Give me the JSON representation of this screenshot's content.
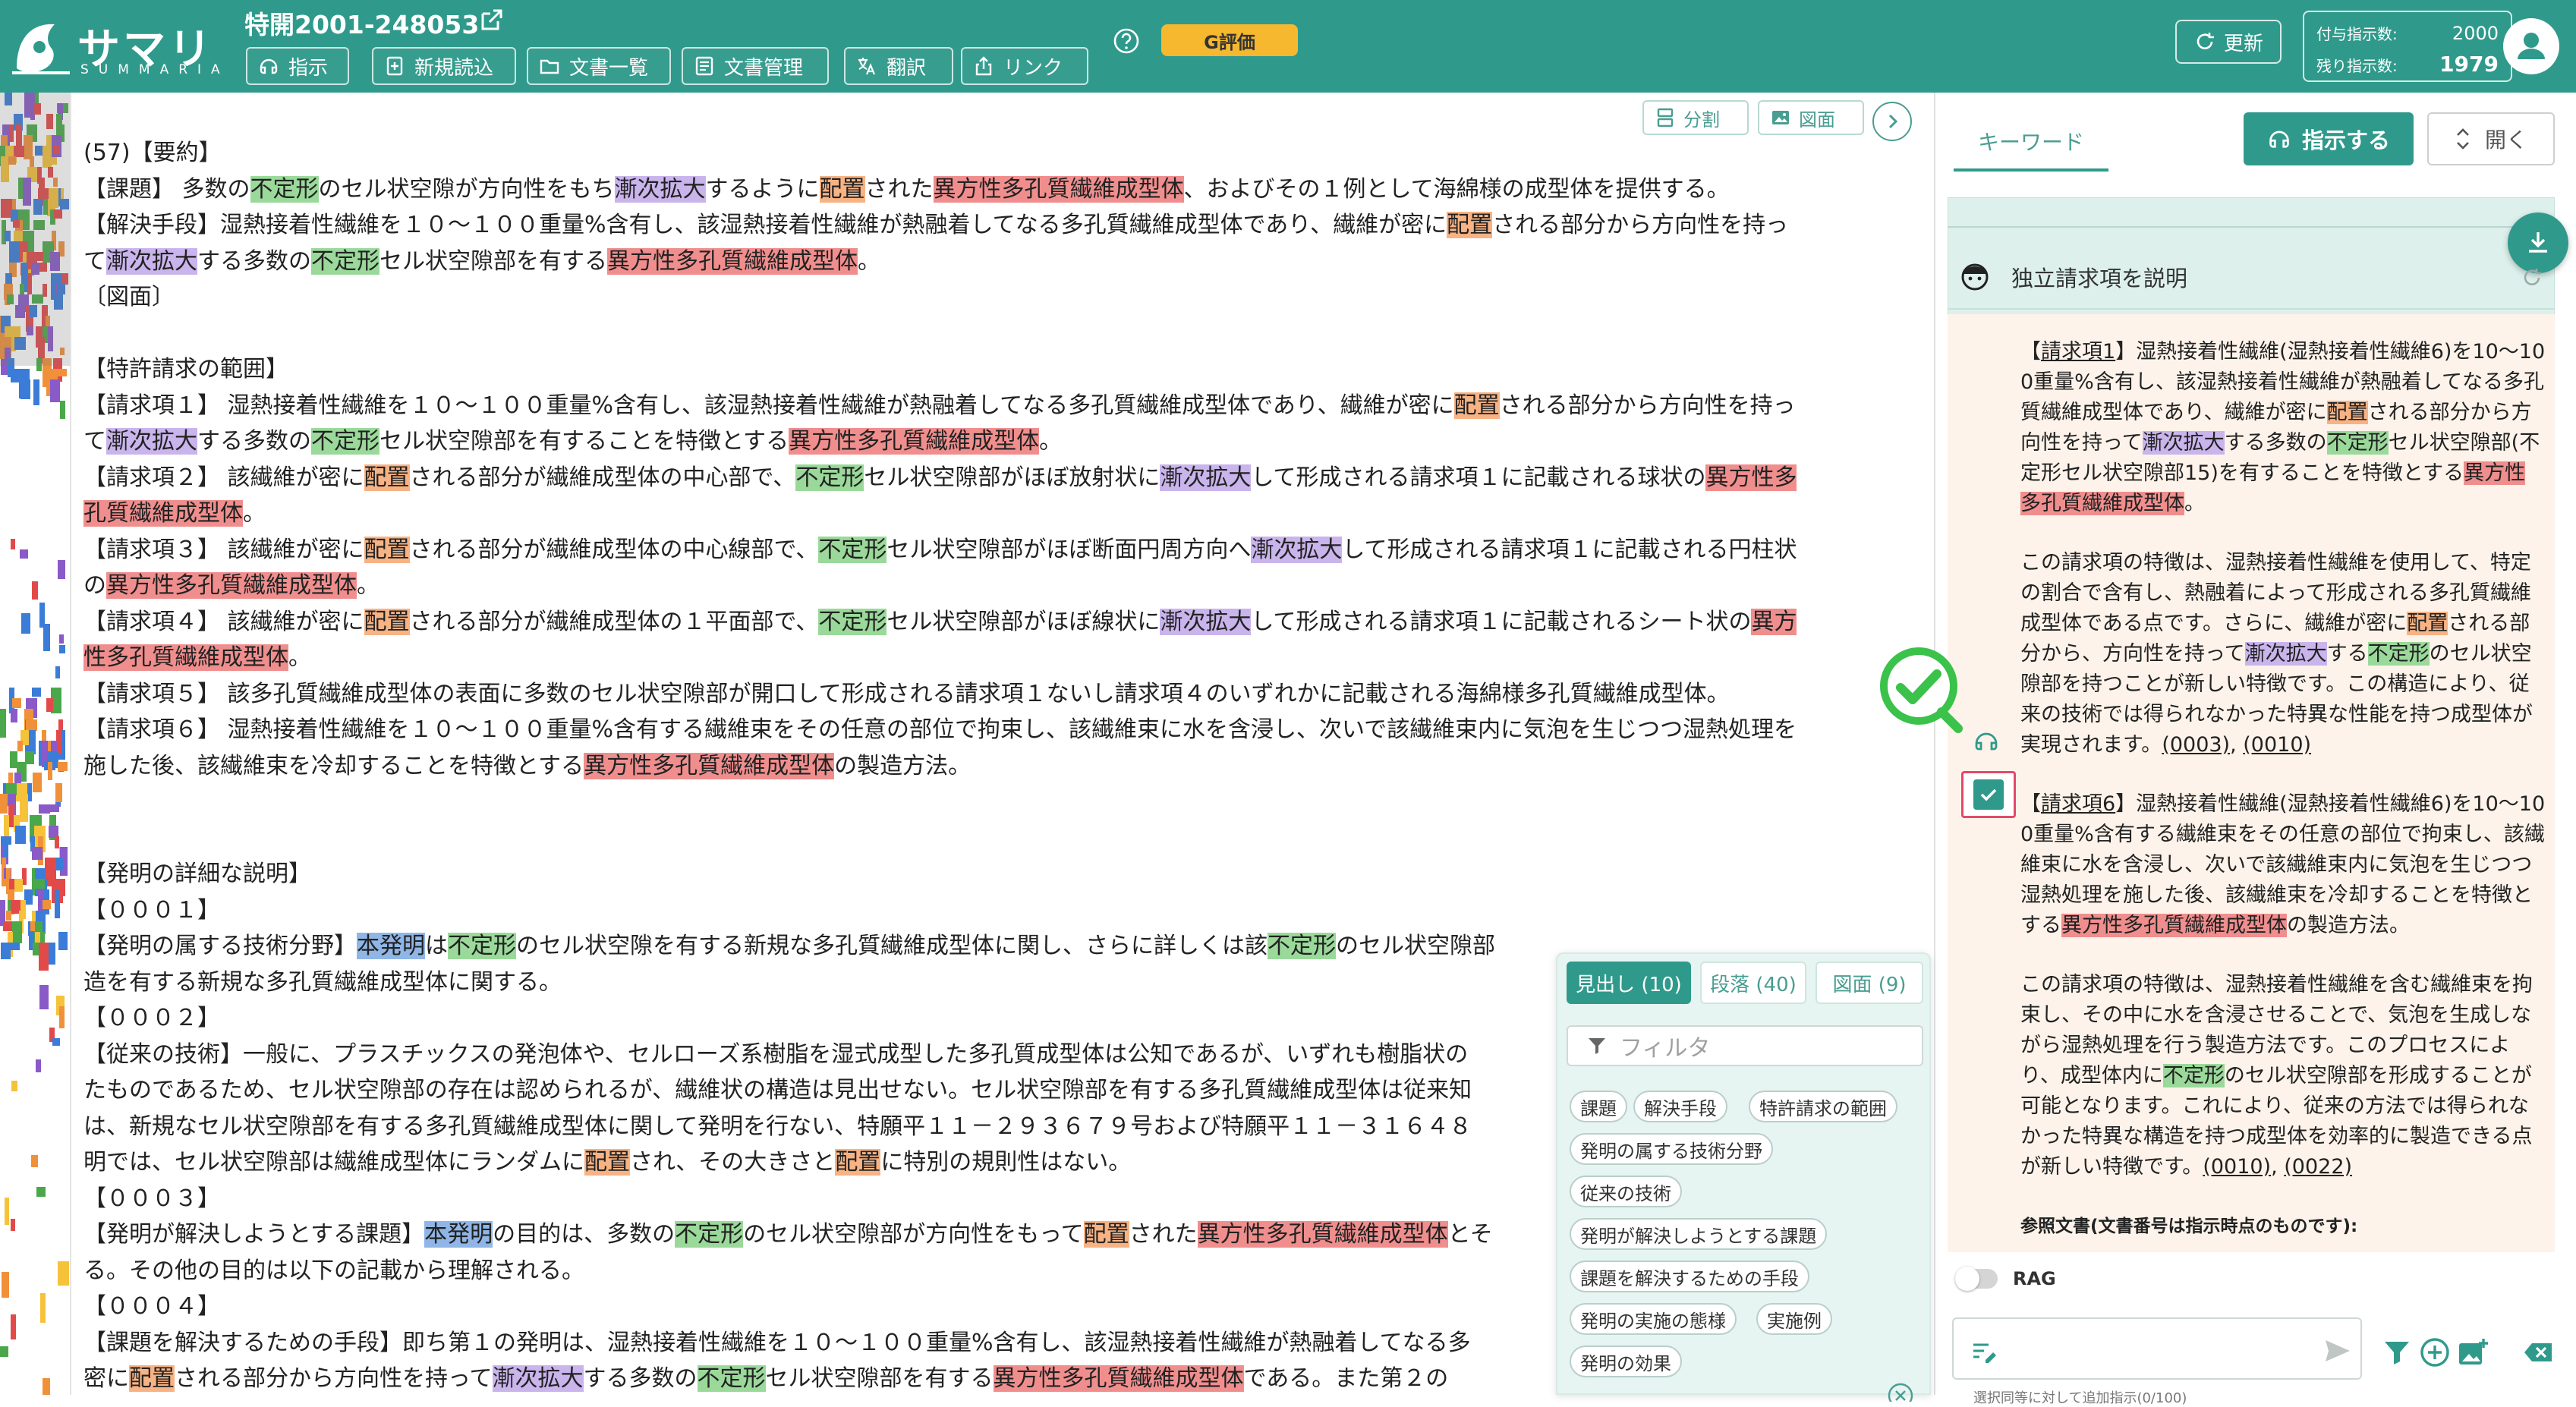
{
  "app": {
    "logo_jp": "サマリア",
    "logo_en": "SUMMARIA",
    "patent_number": "特開2001-248053",
    "g_badge": "G評価",
    "update_label": "更新",
    "quota": {
      "granted_label": "付与指示数:",
      "granted_value": "2000",
      "remaining_label": "残り指示数:",
      "remaining_value": "1979"
    }
  },
  "toolbar": [
    {
      "label": "指示",
      "icon": "chatbot-icon"
    },
    {
      "label": "新規読込",
      "icon": "add-document-icon"
    },
    {
      "label": "文書一覧",
      "icon": "folder-icon"
    },
    {
      "label": "文書管理",
      "icon": "list-document-icon"
    },
    {
      "label": "翻訳",
      "icon": "translate-icon"
    },
    {
      "label": "リンク",
      "icon": "share-icon"
    }
  ],
  "doc_tools": {
    "split_label": "分割",
    "figure_label": "図面"
  },
  "document": {
    "lines": [
      [
        [
          "(57)【要約】",
          ""
        ]
      ],
      [
        [
          "【課題】 多数の",
          ""
        ],
        [
          "不定形",
          "g"
        ],
        [
          "のセル状空隙が方向性をもち",
          ""
        ],
        [
          "漸次拡大",
          "p"
        ],
        [
          "するように",
          ""
        ],
        [
          "配置",
          "o"
        ],
        [
          "された",
          ""
        ],
        [
          "異方性多孔質繊維成型体",
          "r"
        ],
        [
          "、およびその１例として海綿様の成型体を提供する。",
          ""
        ]
      ],
      [
        [
          "【解決手段】湿熱接着性繊維を１０～１００重量%含有し、該湿熱接着性繊維が熱融着してなる多孔質繊維成型体であり、繊維が密に",
          ""
        ],
        [
          "配置",
          "o"
        ],
        [
          "される部分から方向性を持っ",
          ""
        ]
      ],
      [
        [
          "て",
          ""
        ],
        [
          "漸次拡大",
          "p"
        ],
        [
          "する多数の",
          ""
        ],
        [
          "不定形",
          "g"
        ],
        [
          "セル状空隙部を有する",
          ""
        ],
        [
          "異方性多孔質繊維成型体",
          "r"
        ],
        [
          "。",
          ""
        ]
      ],
      [
        [
          "〔図面〕",
          ""
        ]
      ],
      [
        [
          "",
          ""
        ]
      ],
      [
        [
          "【特許請求の範囲】",
          ""
        ]
      ],
      [
        [
          "【請求項１】 湿熱接着性繊維を１０～１００重量%含有し、該湿熱接着性繊維が熱融着してなる多孔質繊維成型体であり、繊維が密に",
          ""
        ],
        [
          "配置",
          "o"
        ],
        [
          "される部分から方向性を持っ",
          ""
        ]
      ],
      [
        [
          "て",
          ""
        ],
        [
          "漸次拡大",
          "p"
        ],
        [
          "する多数の",
          ""
        ],
        [
          "不定形",
          "g"
        ],
        [
          "セル状空隙部を有することを特徴とする",
          ""
        ],
        [
          "異方性多孔質繊維成型体",
          "r"
        ],
        [
          "。",
          ""
        ]
      ],
      [
        [
          "【請求項２】 該繊維が密に",
          ""
        ],
        [
          "配置",
          "o"
        ],
        [
          "される部分が繊維成型体の中心部で、",
          ""
        ],
        [
          "不定形",
          "g"
        ],
        [
          "セル状空隙部がほぼ放射状に",
          ""
        ],
        [
          "漸次拡大",
          "p"
        ],
        [
          "して形成される請求項１に記載される球状の",
          ""
        ],
        [
          "異方性多",
          "r"
        ]
      ],
      [
        [
          "孔質繊維成型体",
          "r"
        ],
        [
          "。",
          ""
        ]
      ],
      [
        [
          "【請求項３】 該繊維が密に",
          ""
        ],
        [
          "配置",
          "o"
        ],
        [
          "される部分が繊維成型体の中心線部で、",
          ""
        ],
        [
          "不定形",
          "g"
        ],
        [
          "セル状空隙部がほぼ断面円周方向へ",
          ""
        ],
        [
          "漸次拡大",
          "p"
        ],
        [
          "して形成される請求項１に記載される円柱状",
          ""
        ]
      ],
      [
        [
          "の",
          ""
        ],
        [
          "異方性多孔質繊維成型体",
          "r"
        ],
        [
          "。",
          ""
        ]
      ],
      [
        [
          "【請求項４】 該繊維が密に",
          ""
        ],
        [
          "配置",
          "o"
        ],
        [
          "される部分が繊維成型体の１平面部で、",
          ""
        ],
        [
          "不定形",
          "g"
        ],
        [
          "セル状空隙部がほぼ線状に",
          ""
        ],
        [
          "漸次拡大",
          "p"
        ],
        [
          "して形成される請求項１に記載されるシート状の",
          ""
        ],
        [
          "異方",
          "r"
        ]
      ],
      [
        [
          "性多孔質繊維成型体",
          "r"
        ],
        [
          "。",
          ""
        ]
      ],
      [
        [
          "【請求項５】 該多孔質繊維成型体の表面に多数のセル状空隙部が開口して形成される請求項１ないし請求項４のいずれかに記載される海綿様多孔質繊維成型体。",
          ""
        ]
      ],
      [
        [
          "【請求項６】 湿熱接着性繊維を１０～１００重量%含有する繊維束をその任意の部位で拘束し、該繊維束に水を含浸し、次いで該繊維束内に気泡を生じつつ湿熱処理を",
          ""
        ]
      ],
      [
        [
          "施した後、該繊維束を冷却することを特徴とする",
          ""
        ],
        [
          "異方性多孔質繊維成型体",
          "r"
        ],
        [
          "の製造方法。",
          ""
        ]
      ],
      [
        [
          "",
          ""
        ]
      ],
      [
        [
          "",
          ""
        ]
      ],
      [
        [
          "【発明の詳細な説明】",
          ""
        ]
      ],
      [
        [
          "【０００１】",
          ""
        ]
      ],
      [
        [
          "【発明の属する技術分野】",
          ""
        ],
        [
          "本発明",
          "b"
        ],
        [
          "は",
          ""
        ],
        [
          "不定形",
          "g"
        ],
        [
          "のセル状空隙を有する新規な多孔質繊維成型体に関し、さらに詳しくは該",
          ""
        ],
        [
          "不定形",
          "g"
        ],
        [
          "のセル状空隙部",
          ""
        ]
      ],
      [
        [
          "造を有する新規な多孔質繊維成型体に関する。",
          ""
        ]
      ],
      [
        [
          "【０００２】",
          ""
        ]
      ],
      [
        [
          "【従来の技術】一般に、プラスチックスの発泡体や、セルローズ系樹脂を湿式成型した多孔質成型体は公知であるが、いずれも樹脂状の",
          ""
        ]
      ],
      [
        [
          "たものであるため、セル状空隙部の存在は認められるが、繊維状の構造は見出せない。セル状空隙部を有する多孔質繊維成型体は従来知",
          ""
        ]
      ],
      [
        [
          "は、新規なセル状空隙部を有する多孔質繊維成型体に関して発明を行ない、特願平１１－２９３６７９号および特願平１１－３１６４８",
          ""
        ]
      ],
      [
        [
          "明では、セル状空隙部は繊維成型体にランダムに",
          ""
        ],
        [
          "配置",
          "o"
        ],
        [
          "され、その大きさと",
          ""
        ],
        [
          "配置",
          "o"
        ],
        [
          "に特別の規則性はない。",
          ""
        ]
      ],
      [
        [
          "【０００３】",
          ""
        ]
      ],
      [
        [
          "【発明が解決しようとする課題】",
          ""
        ],
        [
          "本発明",
          "b"
        ],
        [
          "の目的は、多数の",
          ""
        ],
        [
          "不定形",
          "g"
        ],
        [
          "のセル状空隙部が方向性をもって",
          ""
        ],
        [
          "配置",
          "o"
        ],
        [
          "された",
          ""
        ],
        [
          "異方性多孔質繊維成型体",
          "r"
        ],
        [
          "とそ",
          ""
        ]
      ],
      [
        [
          "る。その他の目的は以下の記載から理解される。",
          ""
        ]
      ],
      [
        [
          "【０００４】",
          ""
        ]
      ],
      [
        [
          "【課題を解決するための手段】即ち第１の発明は、湿熱接着性繊維を１０～１００重量%含有し、該湿熱接着性繊維が熱融着してなる多",
          ""
        ]
      ],
      [
        [
          "密に",
          ""
        ],
        [
          "配置",
          "o"
        ],
        [
          "される部分から方向性を持って",
          ""
        ],
        [
          "漸次拡大",
          "p"
        ],
        [
          "する多数の",
          ""
        ],
        [
          "不定形",
          "g"
        ],
        [
          "セル状空隙部を有する",
          ""
        ],
        [
          "異方性多孔質繊維成型体",
          "r"
        ],
        [
          "である。また第２の",
          ""
        ]
      ]
    ]
  },
  "navigator": {
    "tabs": [
      {
        "label": "見出し (10)",
        "active": true
      },
      {
        "label": "段落 (40)",
        "active": false
      },
      {
        "label": "図面 (9)",
        "active": false
      }
    ],
    "filter_placeholder": "フィルタ",
    "chips": [
      "課題",
      "解決手段",
      "特許請求の範囲",
      "発明の属する技術分野",
      "従来の技術",
      "発明が解決しようとする課題",
      "課題を解決するための手段",
      "発明の実施の態様",
      "実施例",
      "発明の効果"
    ]
  },
  "right_panel": {
    "keyword_tab": "キーワード",
    "instruct_label": "指示する",
    "open_label": "開く",
    "claim_header": "独立請求項を説明",
    "claim1": [
      [
        "【",
        ""
      ],
      [
        "請求項1",
        "u"
      ],
      [
        "】湿熱接着性繊維(湿熱接着性繊維6)を10～100重量%含有し、該湿熱接着性繊維が熱融着してなる多孔質繊維成型体であり、繊維が密に",
        ""
      ],
      [
        "配置",
        "o"
      ],
      [
        "される部分から方向性を持って",
        ""
      ],
      [
        "漸次拡大",
        "p"
      ],
      [
        "する多数の",
        ""
      ],
      [
        "不定形",
        "g"
      ],
      [
        "セル状空隙部(不定形セル状空隙部15)を有することを特徴とする",
        ""
      ],
      [
        "異方性多孔質繊維成型体",
        "r"
      ],
      [
        "。",
        ""
      ]
    ],
    "explain1": [
      [
        "この請求項の特徴は、湿熱接着性繊維を使用して、特定の割合で含有し、熱融着によって形成される多孔質繊維成型体である点です。さらに、繊維が密に",
        ""
      ],
      [
        "配置",
        "o"
      ],
      [
        "される部分から、方向性を持って",
        ""
      ],
      [
        "漸次拡大",
        "p"
      ],
      [
        "する",
        ""
      ],
      [
        "不定形",
        "g"
      ],
      [
        "のセル状空隙部を持つことが新しい特徴です。この構造により、従来の技術では得られなかった特異な性能を持つ成型体が実現されます。",
        ""
      ],
      [
        "(0003)",
        "l"
      ],
      [
        ", ",
        ""
      ],
      [
        "(0010)",
        "l"
      ]
    ],
    "claim6": [
      [
        "【",
        ""
      ],
      [
        "請求項6",
        "u"
      ],
      [
        "】湿熱接着性繊維(湿熱接着性繊維6)を10～100重量%含有する繊維束をその任意の部位で拘束し、該繊維束に水を含浸し、次いで該繊維束内に気泡を生じつつ湿熱処理を施した後、該繊維束を冷却することを特徴とする",
        ""
      ],
      [
        "異方性多孔質繊維成型体",
        "r"
      ],
      [
        "の製造方法。",
        ""
      ]
    ],
    "explain6": [
      [
        "この請求項の特徴は、湿熱接着性繊維を含む繊維束を拘束し、その中に水を含浸させることで、気泡を生成しながら湿熱処理を行う製造方法です。このプロセスにより、成型体内に",
        ""
      ],
      [
        "不定形",
        "g"
      ],
      [
        "のセル状空隙部を形成することが可能となります。これにより、従来の方法では得られなかった特異な構造を持つ成型体を効率的に製造できる点が新しい特徴です。",
        ""
      ],
      [
        "(0010)",
        "l"
      ],
      [
        ", ",
        ""
      ],
      [
        "(0022)",
        "l"
      ]
    ],
    "ref_title": "参照文書(文書番号は指示時点のものです):",
    "rag_label": "RAG",
    "bottom_note": "選択同等に対して追加指示(0/100)"
  },
  "colors": {
    "header": "#2f9a8b",
    "accent": "#2f9a8b",
    "badge": "#f5b82e",
    "hl_green": "#9ad99a",
    "hl_purple": "#c9b4ec",
    "hl_orange": "#f7b384",
    "hl_red": "#f08e8e",
    "hl_blue": "#8fb6e6"
  }
}
